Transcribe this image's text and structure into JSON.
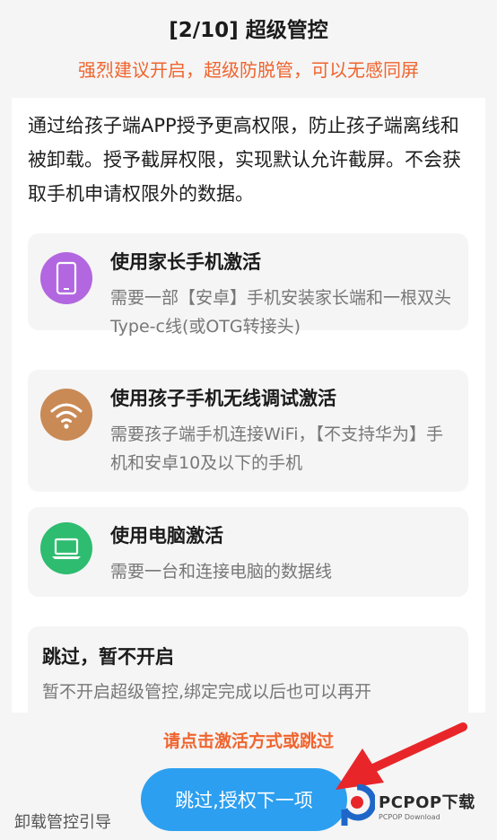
{
  "header": {
    "title": "[2/10] 超级管控",
    "subtitle": "强烈建议开启，超级防脱管，可以无感同屏"
  },
  "description": "通过给孩子端APP授予更高权限，防止孩子端离线和被卸载。授予截屏权限，实现默认允许截屏。不会获取手机申请权限外的数据。",
  "options": [
    {
      "title": "使用家长手机激活",
      "desc": "需要一部【安卓】手机安装家长端和一根双头Type-c线(或OTG转接头)",
      "icon": "smartphone-icon",
      "color": "#b266e0"
    },
    {
      "title": "使用孩子手机无线调试激活",
      "desc": "需要孩子端手机连接WiFi，【不支持华为】手机和安卓10及以下的手机",
      "icon": "wifi-icon",
      "color": "#c98a56"
    },
    {
      "title": "使用电脑激活",
      "desc": "需要一台和连接电脑的数据线",
      "icon": "laptop-icon",
      "color": "#2ebc70"
    }
  ],
  "skip": {
    "title": "跳过，暂不开启",
    "desc": "暂不开启超级管控,绑定完成以后也可以再开"
  },
  "footer": {
    "hint": "请点击激活方式或跳过",
    "next_label": "跳过,授权下一项",
    "uninstall_label": "卸载管控引导"
  },
  "watermark": {
    "brand": "PCPOP下载",
    "sub": "PCPOP Download"
  },
  "colors": {
    "accent": "#f0642e",
    "primary_button": "#2c9ff0",
    "arrow": "#e8262a"
  }
}
